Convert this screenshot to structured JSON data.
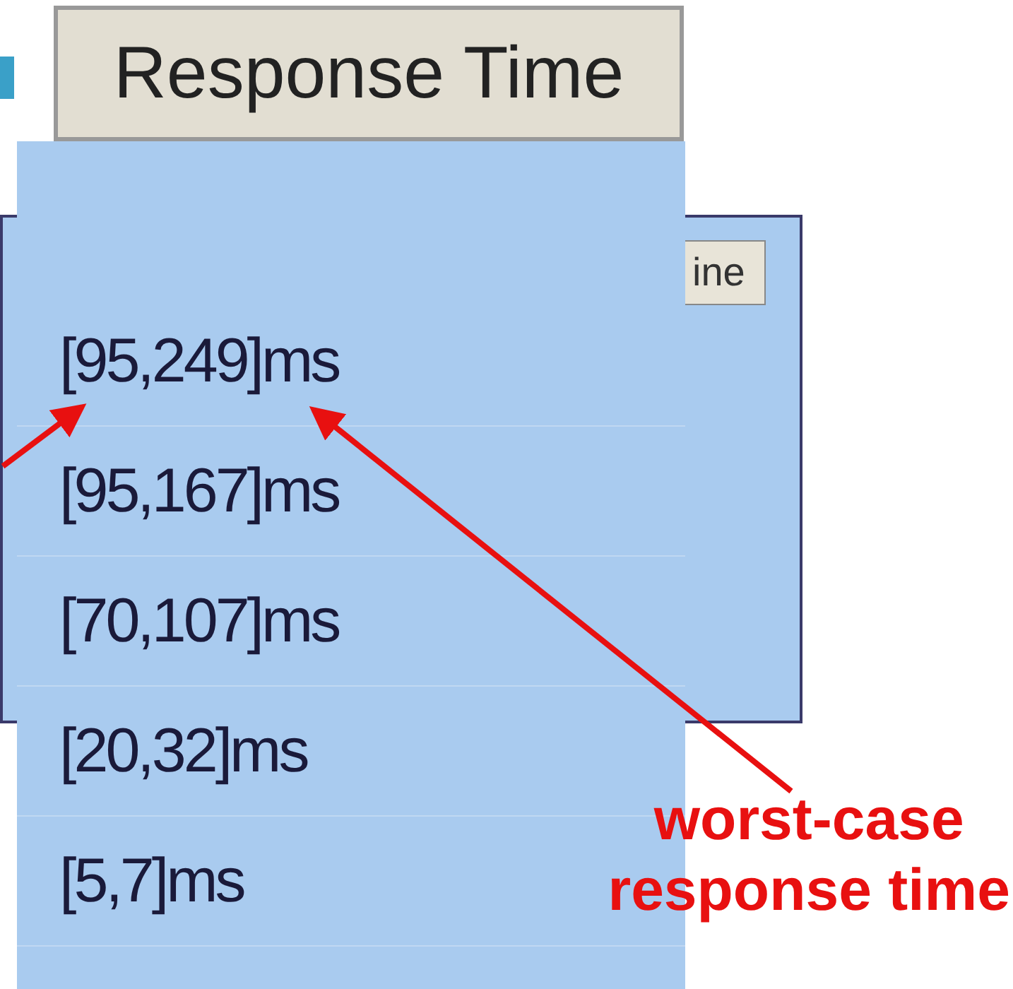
{
  "column_header": {
    "label": "Response Time"
  },
  "background_table": {
    "header_fragment": "ine"
  },
  "response_times": [
    {
      "text": "[95,249]ms"
    },
    {
      "text": "[95,167]ms"
    },
    {
      "text": "[70,107]ms"
    },
    {
      "text": "[20,32]ms"
    },
    {
      "text": "[5,7]ms"
    }
  ],
  "annotation": {
    "lines": [
      "worst-case",
      "response time"
    ]
  }
}
